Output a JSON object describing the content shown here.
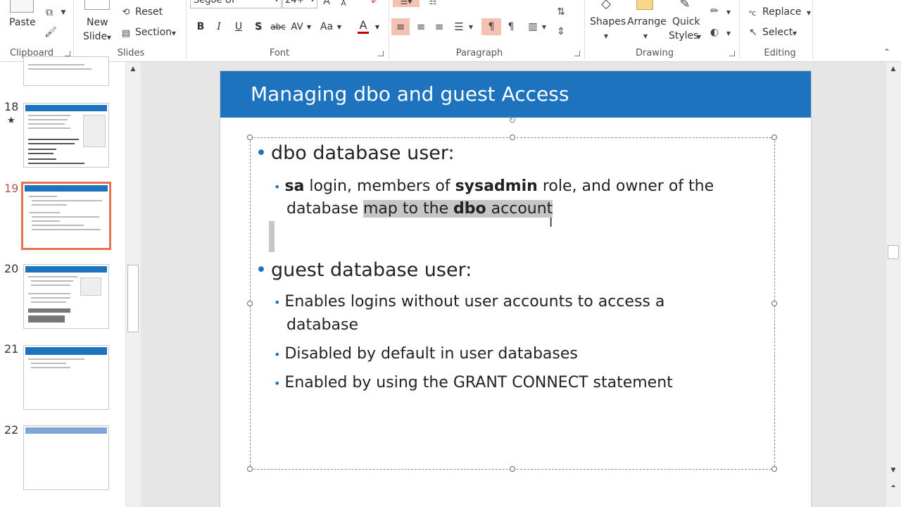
{
  "ribbon": {
    "clipboard": {
      "paste_label": "Paste",
      "group_label": "Clipboard"
    },
    "slides": {
      "new_slide_line1": "New",
      "new_slide_line2": "Slide",
      "reset_label": "Reset",
      "section_label": "Section",
      "group_label": "Slides"
    },
    "font": {
      "font_name": "Segoe UI",
      "font_size": "24+",
      "group_label": "Font",
      "bold": "B",
      "italic": "I",
      "underline": "U",
      "shadow": "S",
      "strike": "abc",
      "spacing": "AV",
      "change_case": "Aa",
      "color": "A"
    },
    "paragraph": {
      "group_label": "Paragraph"
    },
    "drawing": {
      "shapes_label": "Shapes",
      "arrange_label": "Arrange",
      "quick_styles_line1": "Quick",
      "quick_styles_line2": "Styles",
      "group_label": "Drawing"
    },
    "editing": {
      "replace_label": "Replace",
      "select_label": "Select",
      "group_label": "Editing"
    },
    "colors": {
      "accent_highlight": "#f4c1b2",
      "font_color_bar": "#c00000"
    }
  },
  "thumbnails": [
    {
      "number": "18",
      "has_star": true,
      "star": "★",
      "selected": false
    },
    {
      "number": "19",
      "has_star": false,
      "selected": true
    },
    {
      "number": "20",
      "has_star": false,
      "selected": false
    },
    {
      "number": "21",
      "has_star": false,
      "selected": false
    },
    {
      "number": "22",
      "has_star": false,
      "selected": false
    }
  ],
  "slide": {
    "title": "Managing dbo and guest Access",
    "header_color": "#1e73be",
    "bullets": {
      "b1": "dbo database user:",
      "b1_sub1_sa": "sa",
      "b1_sub1_mid": " login, members of ",
      "b1_sub1_sysadmin": "sysadmin",
      "b1_sub1_end": " role, and owner of the",
      "b1_sub1_line2_start": "database ",
      "b1_sub1_line2_hl1": "map to the ",
      "b1_sub1_line2_dbo": "dbo",
      "b1_sub1_line2_hl2": " account ",
      "b2": "guest database user:",
      "b2_sub1_line1": "Enables logins without user accounts to access a",
      "b2_sub1_line2": "database",
      "b2_sub2": "Disabled by default in user databases",
      "b2_sub3": "Enabled by using the GRANT CONNECT statement"
    }
  }
}
